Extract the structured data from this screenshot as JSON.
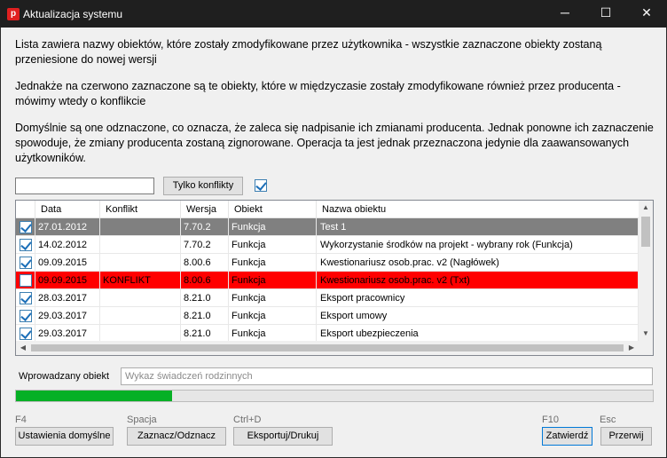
{
  "window": {
    "title": "Aktualizacja systemu",
    "minimize": "─",
    "maximize": "☐",
    "close": "✕",
    "app_icon_letter": "p"
  },
  "info": {
    "p1": "Lista zawiera nazwy obiektów, które zostały zmodyfikowane przez użytkownika - wszystkie zaznaczone obiekty zostaną przeniesione do nowej wersji",
    "p2": "Jednakże na czerwono zaznaczone są te obiekty, które w międzyczasie zostały zmodyfikowane również przez producenta - mówimy wtedy o konflikcie",
    "p3": "Domyślnie są one odznaczone, co oznacza, że zaleca się nadpisanie ich zmianami producenta. Jednak ponowne ich zaznaczenie spowoduje, że zmiany producenta zostaną zignorowane. Operacja ta jest jednak przeznaczona jedynie dla zaawansowanych użytkowników."
  },
  "filter": {
    "search_value": "",
    "conflicts_only_label": "Tylko konflikty",
    "select_all_checked": true
  },
  "table": {
    "columns": [
      "Data",
      "Konflikt",
      "Wersja",
      "Obiekt",
      "Nazwa obiektu"
    ],
    "rows": [
      {
        "checked": true,
        "date": "27.01.2012",
        "conflict": "",
        "version": "7.70.2",
        "object": "Funkcja",
        "name": "Test 1",
        "state": "selected"
      },
      {
        "checked": true,
        "date": "14.02.2012",
        "conflict": "",
        "version": "7.70.2",
        "object": "Funkcja",
        "name": "Wykorzystanie środków na projekt - wybrany rok  (Funkcja)",
        "state": "normal"
      },
      {
        "checked": true,
        "date": "09.09.2015",
        "conflict": "",
        "version": "8.00.6",
        "object": "Funkcja",
        "name": "Kwestionariusz osob.prac. v2 (Nagłówek)",
        "state": "normal"
      },
      {
        "checked": false,
        "date": "09.09.2015",
        "conflict": "KONFLIKT",
        "version": "8.00.6",
        "object": "Funkcja",
        "name": "Kwestionariusz osob.prac. v2 (Txt)",
        "state": "conflict"
      },
      {
        "checked": true,
        "date": "28.03.2017",
        "conflict": "",
        "version": "8.21.0",
        "object": "Funkcja",
        "name": "Eksport pracownicy",
        "state": "normal"
      },
      {
        "checked": true,
        "date": "29.03.2017",
        "conflict": "",
        "version": "8.21.0",
        "object": "Funkcja",
        "name": "Eksport umowy",
        "state": "normal"
      },
      {
        "checked": true,
        "date": "29.03.2017",
        "conflict": "",
        "version": "8.21.0",
        "object": "Funkcja",
        "name": "Eksport ubezpieczenia",
        "state": "normal"
      }
    ]
  },
  "current_object": {
    "label": "Wprowadzany obiekt",
    "placeholder": "Wykaz świadczeń rodzinnych"
  },
  "progress": {
    "fraction": 0.245,
    "color": "#06b025"
  },
  "footer": {
    "buttons": [
      {
        "key": "F4",
        "label": "Ustawienia domyślne"
      },
      {
        "key": "Spacja",
        "label": "Zaznacz/Odznacz"
      },
      {
        "key": "Ctrl+D",
        "label": "Eksportuj/Drukuj"
      },
      {
        "key": "F10",
        "label": "Zatwierdź"
      },
      {
        "key": "Esc",
        "label": "Przerwij"
      }
    ]
  },
  "colors": {
    "conflict_row": "#ff0000",
    "selected_row": "#808080",
    "titlebar": "#1f1f1f"
  }
}
